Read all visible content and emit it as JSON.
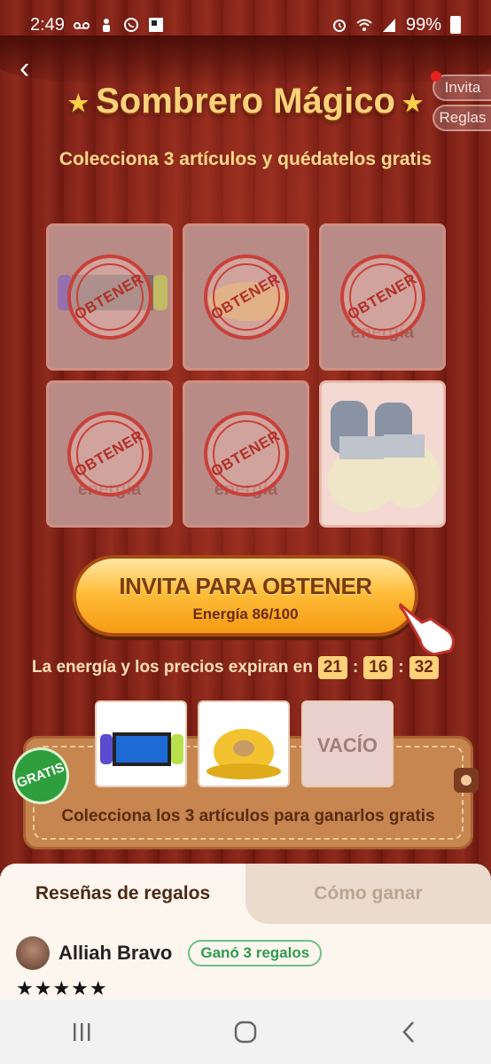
{
  "status": {
    "time": "2:49",
    "battery": "99%"
  },
  "header": {
    "title": "Sombrero Mágico",
    "invite": "Invita",
    "rules": "Reglas"
  },
  "subtitle": "Colecciona 3 artículos y quédatelos gratis",
  "grid": {
    "stamp": "OBTENER",
    "cards": [
      {
        "ghost": ""
      },
      {
        "ghost": ""
      },
      {
        "ghost": "energía"
      },
      {
        "ghost": "energía"
      },
      {
        "ghost": "energía"
      }
    ]
  },
  "cta": {
    "label": "INVITA PARA OBTENER",
    "energy": "Energía 86/100"
  },
  "expiry": {
    "text": "La energía y los precios expiran en",
    "h": "21",
    "m": "16",
    "s": "32"
  },
  "wallet": {
    "empty": "VACÍO",
    "badge": "GRATIS",
    "caption": "Colecciona los 3 artículos para ganarlos gratis"
  },
  "tabs": {
    "reviews": "Reseñas de regalos",
    "how": "Cómo ganar"
  },
  "review": {
    "name": "Alliah Bravo",
    "badge": "Ganó 3 regalos",
    "stars": "★★★★★"
  }
}
